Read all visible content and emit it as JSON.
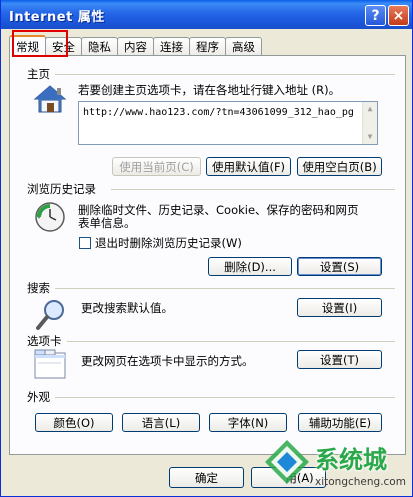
{
  "window": {
    "title": "Internet 属性",
    "help_label": "?",
    "close_label": "×"
  },
  "tabs": [
    {
      "label": "常规",
      "active": true
    },
    {
      "label": "安全"
    },
    {
      "label": "隐私"
    },
    {
      "label": "内容"
    },
    {
      "label": "连接"
    },
    {
      "label": "程序"
    },
    {
      "label": "高级"
    }
  ],
  "homepage": {
    "section": "主页",
    "instruction": "若要创建主页选项卡，请在各地址行键入地址 (R)。",
    "url": "http://www.hao123.com/?tn=43061099_312_hao_pg",
    "use_current": "使用当前页(C)",
    "use_default": "使用默认值(F)",
    "use_blank": "使用空白页(B)"
  },
  "history": {
    "section": "浏览历史记录",
    "desc_line1": "删除临时文件、历史记录、Cookie、保存的密码和网页",
    "desc_line2": "表单信息。",
    "checkbox_label": "退出时删除浏览历史记录(W)",
    "delete_button": "删除(D)...",
    "settings_button": "设置(S)"
  },
  "search": {
    "section": "搜索",
    "desc": "更改搜索默认值。",
    "settings_button": "设置(I)"
  },
  "tabs_section": {
    "section": "选项卡",
    "desc": "更改网页在选项卡中显示的方式。",
    "settings_button": "设置(T)"
  },
  "appearance": {
    "section": "外观",
    "colors": "颜色(O)",
    "languages": "语言(L)",
    "fonts": "字体(N)",
    "accessibility": "辅助功能(E)"
  },
  "footer": {
    "ok": "确定",
    "apply_partial": "用(A)"
  },
  "watermark": {
    "brand": "系统城",
    "site": "xitongcheng.com"
  },
  "colors": {
    "title_blue": "#2466e8",
    "highlight_red": "#e10000",
    "tab_orange": "#e68b2c",
    "watermark_green": "#2aa84a"
  }
}
